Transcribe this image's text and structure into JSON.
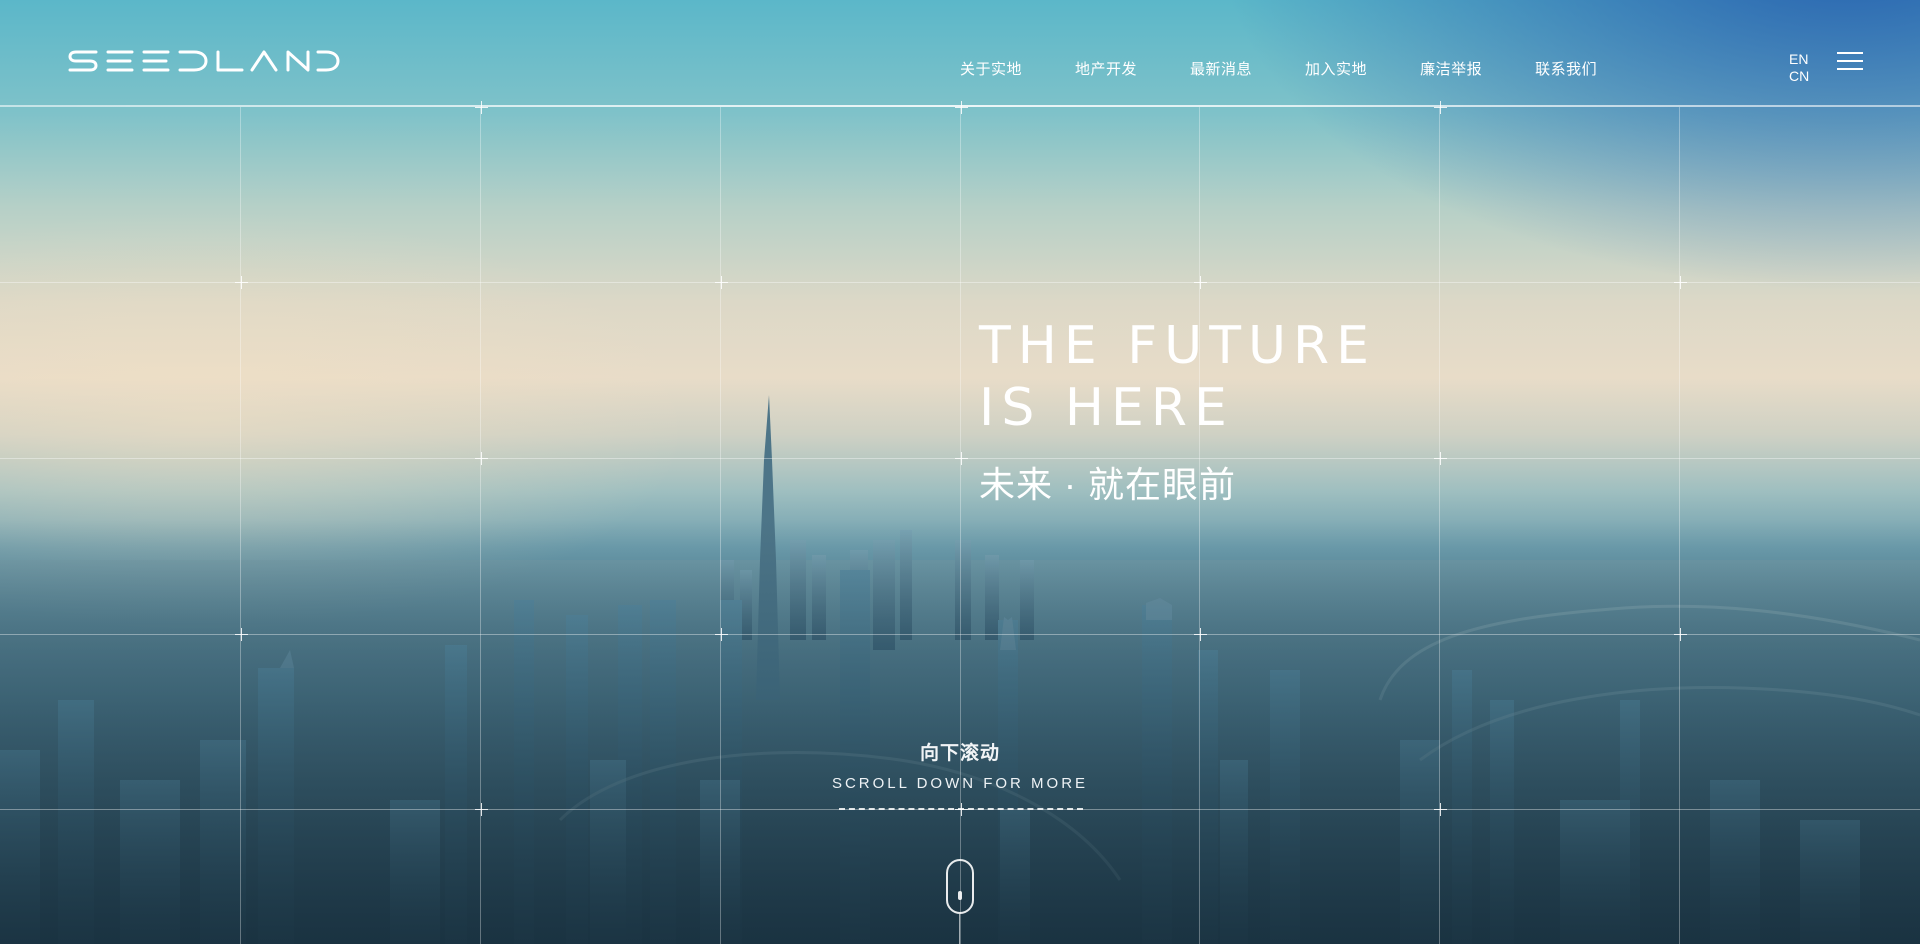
{
  "header": {
    "brand": "SEEDLAND",
    "nav": [
      {
        "label": "关于实地"
      },
      {
        "label": "地产开发"
      },
      {
        "label": "最新消息"
      },
      {
        "label": "加入实地"
      },
      {
        "label": "廉洁举报"
      },
      {
        "label": "联系我们"
      }
    ],
    "lang": {
      "en": "EN",
      "cn": "CN"
    },
    "menu_icon": "hamburger-menu-icon"
  },
  "hero": {
    "headline_line1": "THE FUTURE",
    "headline_line2": "IS HERE",
    "subtitle": "未来 · 就在眼前"
  },
  "scroll": {
    "cn": "向下滚动",
    "en": "SCROLL DOWN FOR MORE",
    "icon": "mouse-scroll-icon"
  }
}
